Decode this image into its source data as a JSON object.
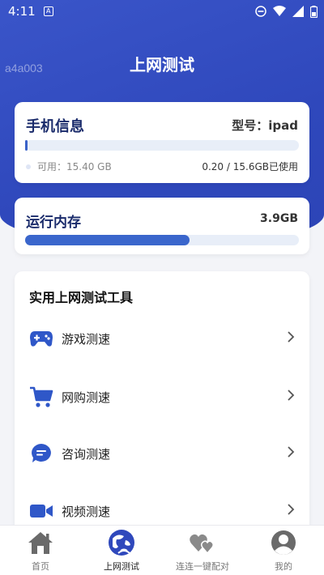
{
  "status": {
    "time": "4:11",
    "notif_glyph": "A"
  },
  "watermark": "a4a003",
  "page_title": "上网测试",
  "phone_info": {
    "title": "手机信息",
    "model_label": "型号：ipad",
    "storage_used_fraction": 0.01,
    "available": "可用：15.40 GB",
    "used": "0.20 / 15.6GB已使用"
  },
  "memory": {
    "title": "运行内存",
    "value": "3.9GB",
    "fill_fraction": 0.6
  },
  "tools": {
    "heading": "实用上网测试工具",
    "items": [
      {
        "label": "游戏测速",
        "icon": "gamepad-icon"
      },
      {
        "label": "网购测速",
        "icon": "cart-icon"
      },
      {
        "label": "咨询测速",
        "icon": "chat-bubble-icon"
      },
      {
        "label": "视频测速",
        "icon": "video-camera-icon"
      }
    ]
  },
  "tabs": [
    {
      "label": "首页",
      "icon": "home-icon"
    },
    {
      "label": "上网测试",
      "icon": "globe-wifi-icon",
      "active": true
    },
    {
      "label": "连连一键配对",
      "icon": "hearts-icon"
    },
    {
      "label": "我的",
      "icon": "profile-icon"
    }
  ],
  "colors": {
    "accent": "#2f48bc",
    "bar": "#3a62c8",
    "title_text": "#1a2b6b"
  }
}
